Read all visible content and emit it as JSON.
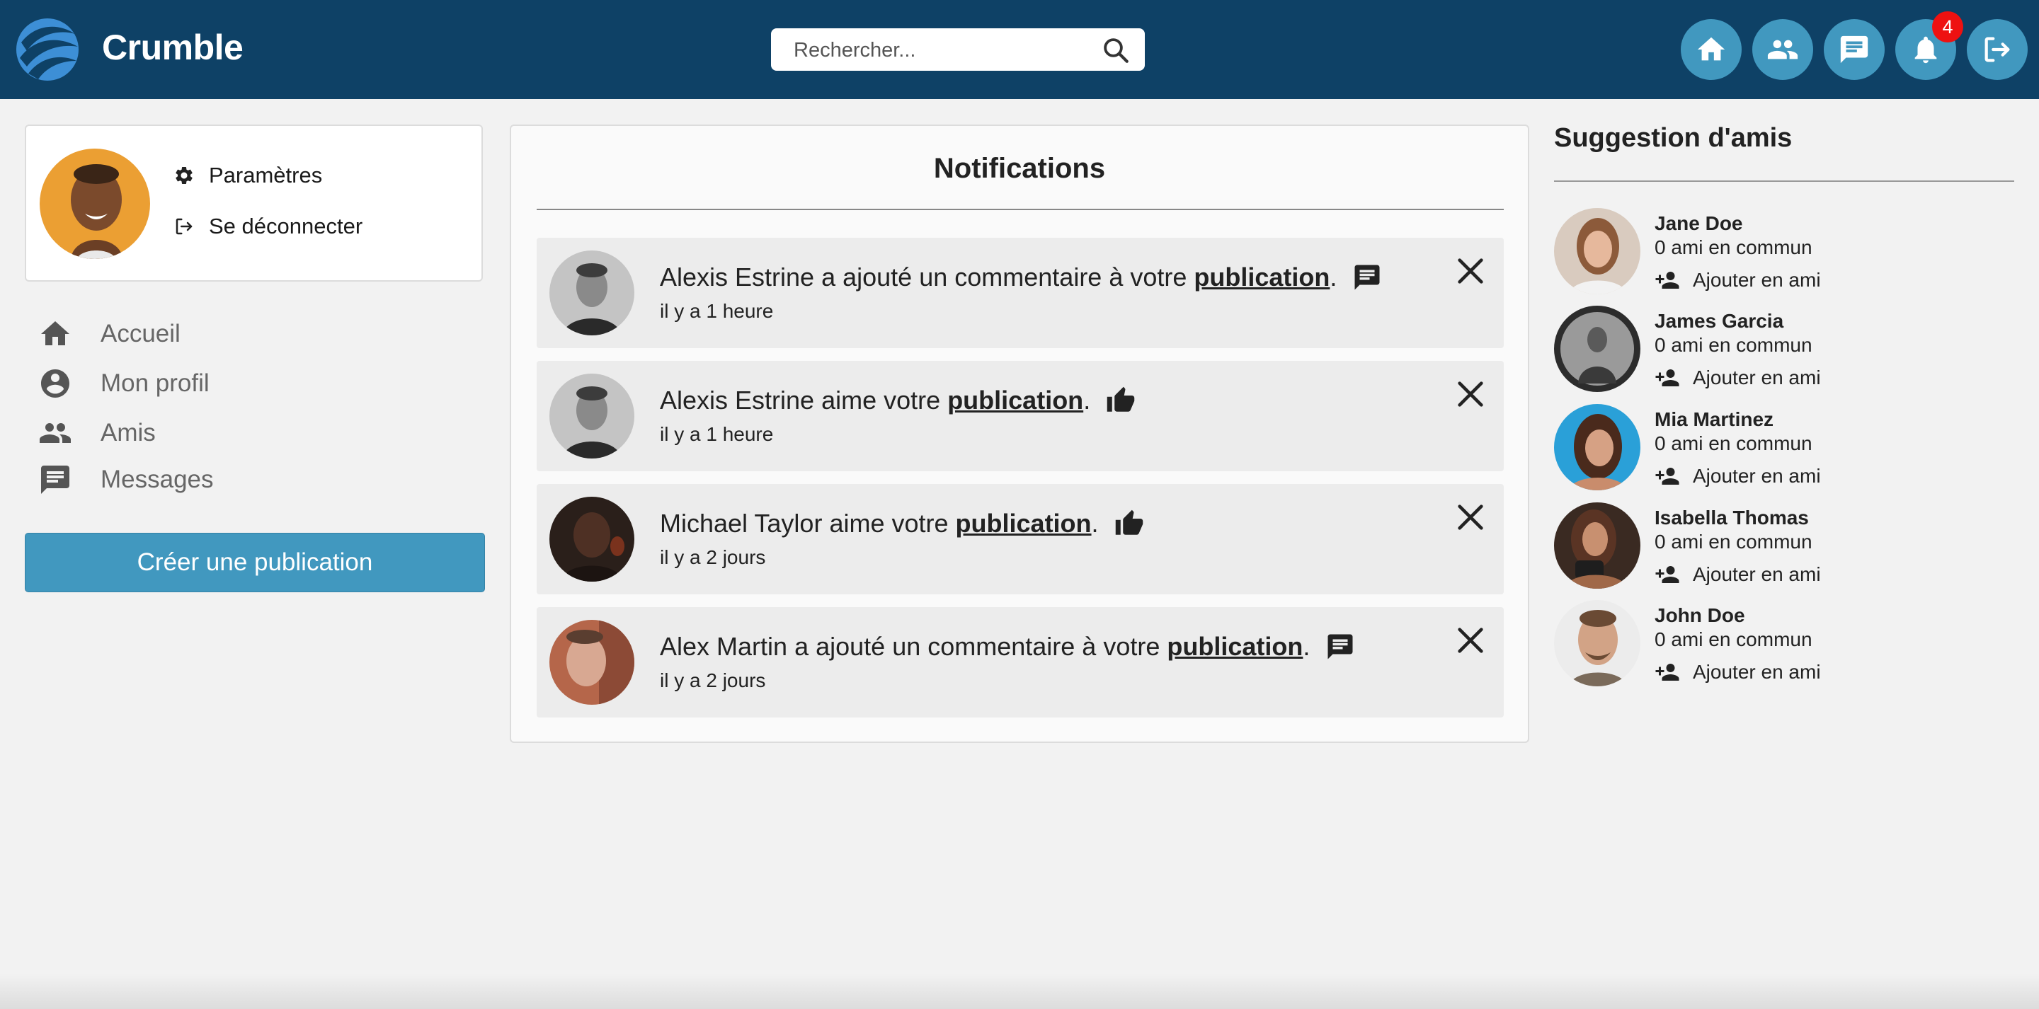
{
  "header": {
    "brand": "Crumble",
    "search_placeholder": "Rechercher...",
    "notification_count": "4",
    "icons": [
      "home-icon",
      "friends-icon",
      "messages-icon",
      "bell-icon",
      "logout-icon"
    ]
  },
  "profile_menu": {
    "settings": "Paramètres",
    "logout": "Se déconnecter"
  },
  "nav": {
    "items": [
      {
        "label": "Accueil",
        "icon": "home-icon"
      },
      {
        "label": "Mon profil",
        "icon": "profile-icon"
      },
      {
        "label": "Amis",
        "icon": "friends-icon"
      },
      {
        "label": "Messages",
        "icon": "messages-icon"
      }
    ],
    "create_post": "Créer une publication"
  },
  "notifications": {
    "title": "Notifications",
    "items": [
      {
        "actor": "Alexis Estrine",
        "action": "a ajouté un commentaire à votre",
        "link": "publication",
        "punct": ".",
        "type": "comment",
        "time": "il y a 1 heure"
      },
      {
        "actor": "Alexis Estrine",
        "action": "aime votre",
        "link": "publication",
        "punct": ".",
        "type": "like",
        "time": "il y a 1 heure"
      },
      {
        "actor": "Michael Taylor",
        "action": "aime votre",
        "link": "publication",
        "punct": ".",
        "type": "like",
        "time": "il y a 2 jours"
      },
      {
        "actor": "Alex Martin",
        "action": "a ajouté un commentaire à votre",
        "link": "publication",
        "punct": ".",
        "type": "comment",
        "time": "il y a 2 jours"
      }
    ]
  },
  "suggestions": {
    "title": "Suggestion d'amis",
    "items": [
      {
        "name": "Jane Doe",
        "mutual": "0 ami en commun",
        "action": "Ajouter en ami"
      },
      {
        "name": "James Garcia",
        "mutual": "0 ami en commun",
        "action": "Ajouter en ami"
      },
      {
        "name": "Mia Martinez",
        "mutual": "0 ami en commun",
        "action": "Ajouter en ami"
      },
      {
        "name": "Isabella Thomas",
        "mutual": "0 ami en commun",
        "action": "Ajouter en ami"
      },
      {
        "name": "John Doe",
        "mutual": "0 ami en commun",
        "action": "Ajouter en ami"
      }
    ]
  },
  "colors": {
    "header_bg": "#0e4166",
    "accent": "#4198bf",
    "badge": "#ee1111",
    "page_bg": "#f2f2f2"
  }
}
